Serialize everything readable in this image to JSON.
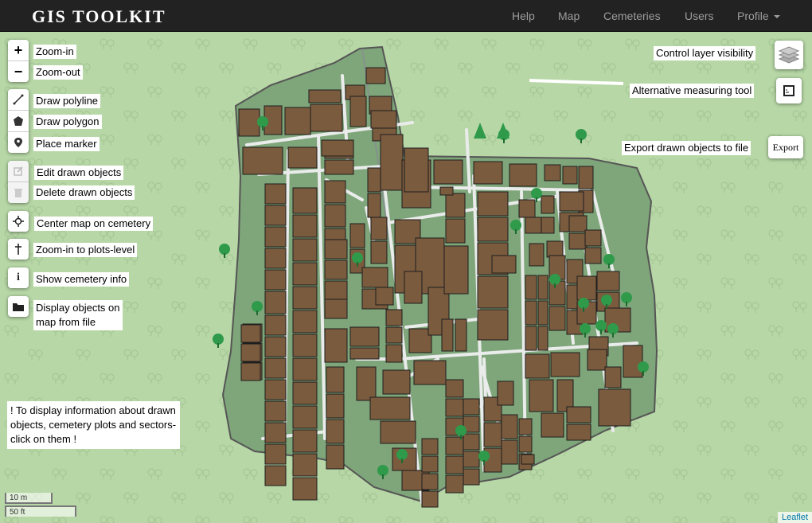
{
  "navbar": {
    "brand": "GIS TOOLKIT",
    "items": [
      {
        "label": "Help"
      },
      {
        "label": "Map"
      },
      {
        "label": "Cemeteries"
      },
      {
        "label": "Users"
      },
      {
        "label": "Profile"
      }
    ]
  },
  "map_controls": {
    "zoom_in_symbol": "+",
    "zoom_out_symbol": "−",
    "zoom_in_label": "Zoom-in",
    "zoom_out_label": "Zoom-out",
    "draw_polyline": "Draw polyline",
    "draw_polygon": "Draw polygon",
    "place_marker": "Place marker",
    "edit_drawn": "Edit drawn objects",
    "delete_drawn": "Delete drawn objects",
    "center_map": "Center map on cemetery",
    "zoom_plots": "Zoom-in to plots-level",
    "cemetery_info": "Show cemetery info",
    "display_file_line1": "Display objects on",
    "display_file_line2": "map from file"
  },
  "right_controls": {
    "layer_visibility": "Control layer visibility",
    "measuring_tool": "Alternative measuring tool",
    "export_label": "Export drawn objects to file",
    "export_button": "Export"
  },
  "note": "! To display information about drawn objects, cemetery plots and sectors- click on them !",
  "scale": {
    "metric": "10 m",
    "imperial": "50 ft"
  },
  "attribution": "Leaflet",
  "colors": {
    "navbar": "#222222",
    "map_background": "#b7d7a6",
    "cemetery_fill": "#7fa57a",
    "plot": "#7b5b3e",
    "path": "#e9ecea",
    "tree": "#2e9a4a"
  },
  "icons": [
    "polyline-icon",
    "polygon-icon",
    "marker-icon",
    "edit-icon",
    "trash-icon",
    "crosshair-icon",
    "cross-icon",
    "info-icon",
    "folder-icon",
    "layers-icon",
    "ruler-icon"
  ]
}
